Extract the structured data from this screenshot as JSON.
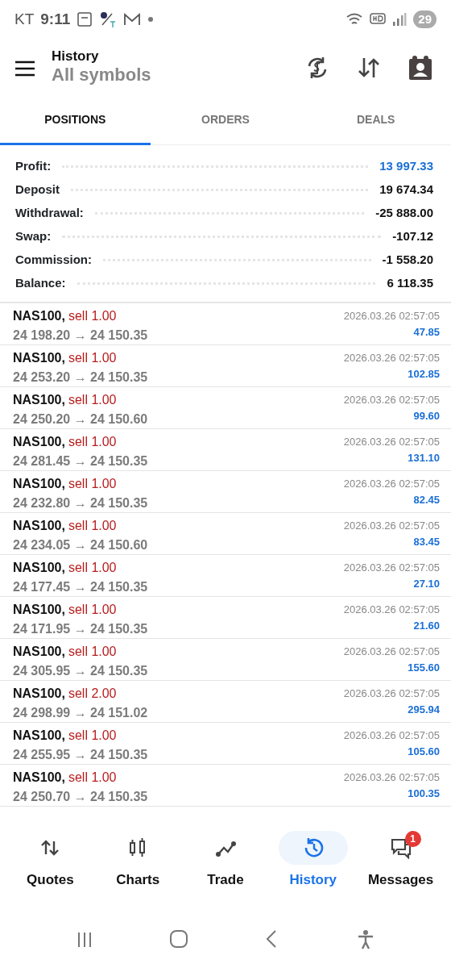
{
  "status_bar": {
    "carrier": "KT",
    "time": "9:11",
    "battery": "29"
  },
  "toolbar": {
    "title": "History",
    "subtitle": "All symbols"
  },
  "tabs": [
    {
      "label": "POSITIONS",
      "selected": true
    },
    {
      "label": "ORDERS",
      "selected": false
    },
    {
      "label": "DEALS",
      "selected": false
    }
  ],
  "summary": [
    {
      "label": "Profit:",
      "value": "13 997.33",
      "color": "#1a6fd6"
    },
    {
      "label": "Deposit",
      "value": "19 674.34",
      "color": "#111111"
    },
    {
      "label": "Withdrawal:",
      "value": "-25 888.00",
      "color": "#111111"
    },
    {
      "label": "Swap:",
      "value": "-107.12",
      "color": "#111111"
    },
    {
      "label": "Commission:",
      "value": "-1 558.20",
      "color": "#111111"
    },
    {
      "label": "Balance:",
      "value": "6 118.35",
      "color": "#111111"
    }
  ],
  "positions": [
    {
      "symbol": "NAS100,",
      "trade": "sell 1.00",
      "prices": "24 198.20 → 24 150.35",
      "time": "2026.03.26 02:57:05",
      "profit": "47.85"
    },
    {
      "symbol": "NAS100,",
      "trade": "sell 1.00",
      "prices": "24 253.20 → 24 150.35",
      "time": "2026.03.26 02:57:05",
      "profit": "102.85"
    },
    {
      "symbol": "NAS100,",
      "trade": "sell 1.00",
      "prices": "24 250.20 → 24 150.60",
      "time": "2026.03.26 02:57:05",
      "profit": "99.60"
    },
    {
      "symbol": "NAS100,",
      "trade": "sell 1.00",
      "prices": "24 281.45 → 24 150.35",
      "time": "2026.03.26 02:57:05",
      "profit": "131.10"
    },
    {
      "symbol": "NAS100,",
      "trade": "sell 1.00",
      "prices": "24 232.80 → 24 150.35",
      "time": "2026.03.26 02:57:05",
      "profit": "82.45"
    },
    {
      "symbol": "NAS100,",
      "trade": "sell 1.00",
      "prices": "24 234.05 → 24 150.60",
      "time": "2026.03.26 02:57:05",
      "profit": "83.45"
    },
    {
      "symbol": "NAS100,",
      "trade": "sell 1.00",
      "prices": "24 177.45 → 24 150.35",
      "time": "2026.03.26 02:57:05",
      "profit": "27.10"
    },
    {
      "symbol": "NAS100,",
      "trade": "sell 1.00",
      "prices": "24 171.95 → 24 150.35",
      "time": "2026.03.26 02:57:05",
      "profit": "21.60"
    },
    {
      "symbol": "NAS100,",
      "trade": "sell 1.00",
      "prices": "24 305.95 → 24 150.35",
      "time": "2026.03.26 02:57:05",
      "profit": "155.60"
    },
    {
      "symbol": "NAS100,",
      "trade": "sell 2.00",
      "prices": "24 298.99 → 24 151.02",
      "time": "2026.03.26 02:57:05",
      "profit": "295.94"
    },
    {
      "symbol": "NAS100,",
      "trade": "sell 1.00",
      "prices": "24 255.95 → 24 150.35",
      "time": "2026.03.26 02:57:05",
      "profit": "105.60"
    },
    {
      "symbol": "NAS100,",
      "trade": "sell 1.00",
      "prices": "24 250.70 → 24 150.35",
      "time": "2026.03.26 02:57:05",
      "profit": "100.35"
    }
  ],
  "bottom_nav": [
    {
      "label": "Quotes",
      "selected": false
    },
    {
      "label": "Charts",
      "selected": false
    },
    {
      "label": "Trade",
      "selected": false
    },
    {
      "label": "History",
      "selected": true
    },
    {
      "label": "Messages",
      "selected": false,
      "badge": "1"
    }
  ]
}
